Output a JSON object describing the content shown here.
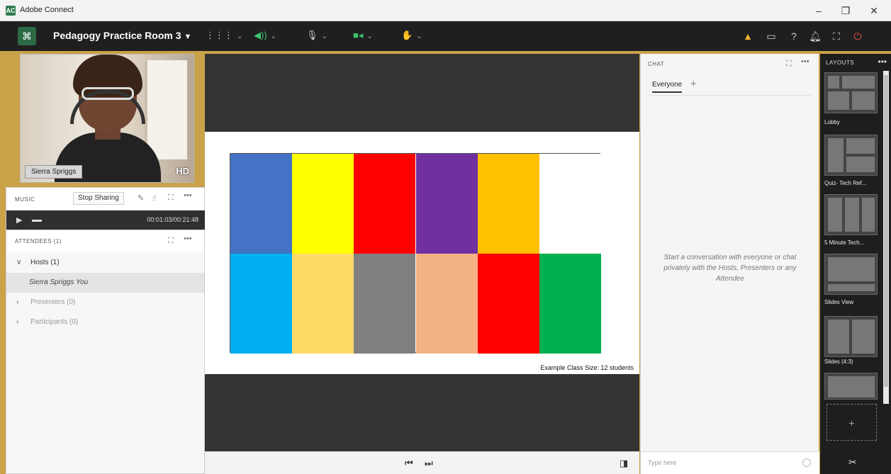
{
  "os": {
    "title": "Adobe Connect",
    "app_icon": "AC",
    "minimize": "–",
    "restore": "❐",
    "close": "✕"
  },
  "toolbar": {
    "room_name": "Pedagogy Practice Room 3",
    "chevron": "⌄"
  },
  "video": {
    "name_tag": "Sierra Spriggs",
    "hd_badge": "HD"
  },
  "music": {
    "title": "MUSIC",
    "stop_sharing": "Stop Sharing",
    "time": "00:01:03/00:21:48"
  },
  "attendees": {
    "title": "ATTENDEES (1)",
    "hosts": "Hosts (1)",
    "host_user": "Sierra Spriggs You",
    "presenters": "Presenters (0)",
    "participants": "Participants (0)"
  },
  "share": {
    "caption": "Example Class Size: 12 students",
    "colors_row1": [
      "#4472c4",
      "#ffff00",
      "#ff0000",
      "#7030a0",
      "#ffc000",
      "#ffffff"
    ],
    "colors_row2": [
      "#00b0f0",
      "#ffd966",
      "#808080",
      "#f4b183",
      "#ff0000",
      "#00b050"
    ]
  },
  "chat": {
    "title": "CHAT",
    "tab_everyone": "Everyone",
    "add": "+",
    "empty_text": "Start a conversation with everyone or chat privately with the Hosts, Presenters or any Attendee",
    "input_placeholder": "Type here"
  },
  "layouts": {
    "title": "LAYOUTS",
    "more": "•••",
    "items": [
      {
        "label": "Lobby"
      },
      {
        "label": "Quiz- Tech Ref..."
      },
      {
        "label": "5 Minute Tech..."
      },
      {
        "label": "Slides View"
      },
      {
        "label": "Slides (4:3)"
      }
    ],
    "add": "+"
  }
}
